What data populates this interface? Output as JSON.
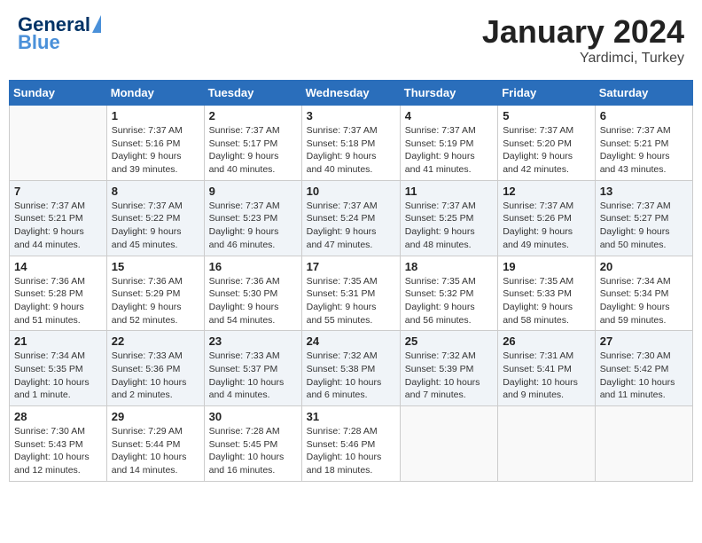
{
  "header": {
    "logo_general": "General",
    "logo_blue": "Blue",
    "month_title": "January 2024",
    "subtitle": "Yardimci, Turkey"
  },
  "weekdays": [
    "Sunday",
    "Monday",
    "Tuesday",
    "Wednesday",
    "Thursday",
    "Friday",
    "Saturday"
  ],
  "weeks": [
    [
      {
        "day": "",
        "info": ""
      },
      {
        "day": "1",
        "info": "Sunrise: 7:37 AM\nSunset: 5:16 PM\nDaylight: 9 hours\nand 39 minutes."
      },
      {
        "day": "2",
        "info": "Sunrise: 7:37 AM\nSunset: 5:17 PM\nDaylight: 9 hours\nand 40 minutes."
      },
      {
        "day": "3",
        "info": "Sunrise: 7:37 AM\nSunset: 5:18 PM\nDaylight: 9 hours\nand 40 minutes."
      },
      {
        "day": "4",
        "info": "Sunrise: 7:37 AM\nSunset: 5:19 PM\nDaylight: 9 hours\nand 41 minutes."
      },
      {
        "day": "5",
        "info": "Sunrise: 7:37 AM\nSunset: 5:20 PM\nDaylight: 9 hours\nand 42 minutes."
      },
      {
        "day": "6",
        "info": "Sunrise: 7:37 AM\nSunset: 5:21 PM\nDaylight: 9 hours\nand 43 minutes."
      }
    ],
    [
      {
        "day": "7",
        "info": "Sunrise: 7:37 AM\nSunset: 5:21 PM\nDaylight: 9 hours\nand 44 minutes."
      },
      {
        "day": "8",
        "info": "Sunrise: 7:37 AM\nSunset: 5:22 PM\nDaylight: 9 hours\nand 45 minutes."
      },
      {
        "day": "9",
        "info": "Sunrise: 7:37 AM\nSunset: 5:23 PM\nDaylight: 9 hours\nand 46 minutes."
      },
      {
        "day": "10",
        "info": "Sunrise: 7:37 AM\nSunset: 5:24 PM\nDaylight: 9 hours\nand 47 minutes."
      },
      {
        "day": "11",
        "info": "Sunrise: 7:37 AM\nSunset: 5:25 PM\nDaylight: 9 hours\nand 48 minutes."
      },
      {
        "day": "12",
        "info": "Sunrise: 7:37 AM\nSunset: 5:26 PM\nDaylight: 9 hours\nand 49 minutes."
      },
      {
        "day": "13",
        "info": "Sunrise: 7:37 AM\nSunset: 5:27 PM\nDaylight: 9 hours\nand 50 minutes."
      }
    ],
    [
      {
        "day": "14",
        "info": "Sunrise: 7:36 AM\nSunset: 5:28 PM\nDaylight: 9 hours\nand 51 minutes."
      },
      {
        "day": "15",
        "info": "Sunrise: 7:36 AM\nSunset: 5:29 PM\nDaylight: 9 hours\nand 52 minutes."
      },
      {
        "day": "16",
        "info": "Sunrise: 7:36 AM\nSunset: 5:30 PM\nDaylight: 9 hours\nand 54 minutes."
      },
      {
        "day": "17",
        "info": "Sunrise: 7:35 AM\nSunset: 5:31 PM\nDaylight: 9 hours\nand 55 minutes."
      },
      {
        "day": "18",
        "info": "Sunrise: 7:35 AM\nSunset: 5:32 PM\nDaylight: 9 hours\nand 56 minutes."
      },
      {
        "day": "19",
        "info": "Sunrise: 7:35 AM\nSunset: 5:33 PM\nDaylight: 9 hours\nand 58 minutes."
      },
      {
        "day": "20",
        "info": "Sunrise: 7:34 AM\nSunset: 5:34 PM\nDaylight: 9 hours\nand 59 minutes."
      }
    ],
    [
      {
        "day": "21",
        "info": "Sunrise: 7:34 AM\nSunset: 5:35 PM\nDaylight: 10 hours\nand 1 minute."
      },
      {
        "day": "22",
        "info": "Sunrise: 7:33 AM\nSunset: 5:36 PM\nDaylight: 10 hours\nand 2 minutes."
      },
      {
        "day": "23",
        "info": "Sunrise: 7:33 AM\nSunset: 5:37 PM\nDaylight: 10 hours\nand 4 minutes."
      },
      {
        "day": "24",
        "info": "Sunrise: 7:32 AM\nSunset: 5:38 PM\nDaylight: 10 hours\nand 6 minutes."
      },
      {
        "day": "25",
        "info": "Sunrise: 7:32 AM\nSunset: 5:39 PM\nDaylight: 10 hours\nand 7 minutes."
      },
      {
        "day": "26",
        "info": "Sunrise: 7:31 AM\nSunset: 5:41 PM\nDaylight: 10 hours\nand 9 minutes."
      },
      {
        "day": "27",
        "info": "Sunrise: 7:30 AM\nSunset: 5:42 PM\nDaylight: 10 hours\nand 11 minutes."
      }
    ],
    [
      {
        "day": "28",
        "info": "Sunrise: 7:30 AM\nSunset: 5:43 PM\nDaylight: 10 hours\nand 12 minutes."
      },
      {
        "day": "29",
        "info": "Sunrise: 7:29 AM\nSunset: 5:44 PM\nDaylight: 10 hours\nand 14 minutes."
      },
      {
        "day": "30",
        "info": "Sunrise: 7:28 AM\nSunset: 5:45 PM\nDaylight: 10 hours\nand 16 minutes."
      },
      {
        "day": "31",
        "info": "Sunrise: 7:28 AM\nSunset: 5:46 PM\nDaylight: 10 hours\nand 18 minutes."
      },
      {
        "day": "",
        "info": ""
      },
      {
        "day": "",
        "info": ""
      },
      {
        "day": "",
        "info": ""
      }
    ]
  ]
}
